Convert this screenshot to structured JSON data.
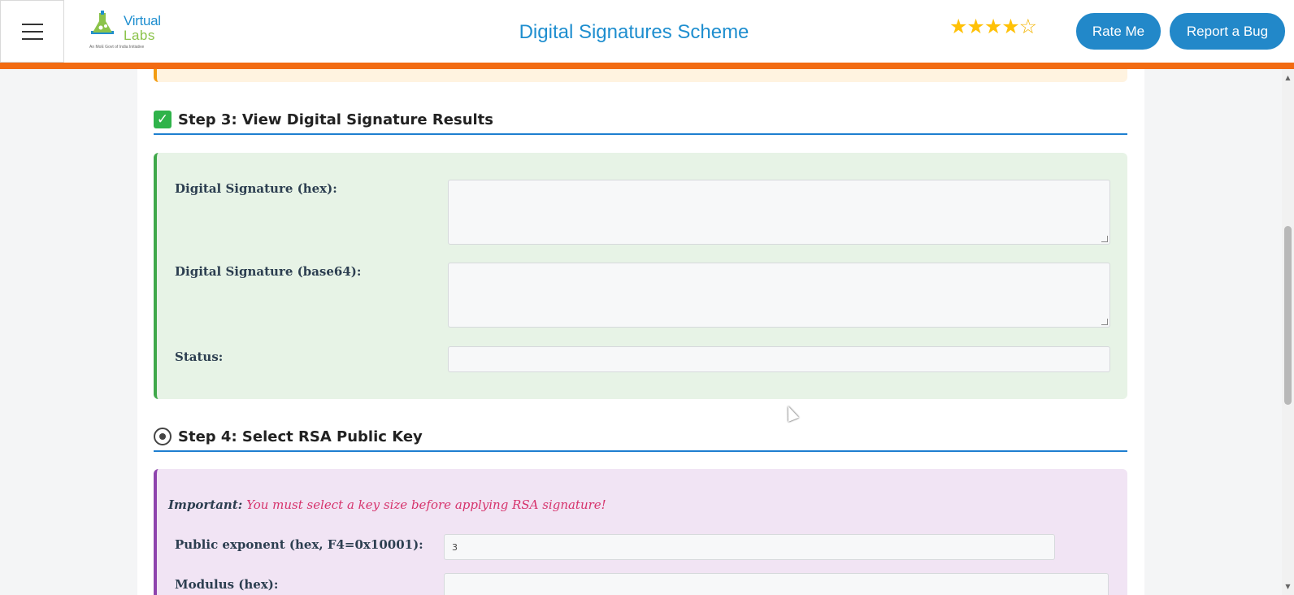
{
  "header": {
    "menu_icon": "hamburger-icon",
    "logo": {
      "line1": "Virtual",
      "line2": "Labs",
      "tagline": "An MoE Govt of India Initiative"
    },
    "title": "Digital Signatures Scheme",
    "rating": {
      "value": 4,
      "max": 5,
      "filled": "★★★★",
      "empty": "☆"
    },
    "rate_button": "Rate Me",
    "bug_button": "Report a Bug",
    "accent_color": "#f26b12"
  },
  "step3": {
    "icon": "check-icon",
    "title": "Step 3: View Digital Signature Results",
    "fields": {
      "sig_hex_label": "Digital Signature (hex):",
      "sig_hex_value": "",
      "sig_b64_label": "Digital Signature (base64):",
      "sig_b64_value": "",
      "status_label": "Status:",
      "status_value": ""
    }
  },
  "step4": {
    "icon": "gear-icon",
    "title": "Step 4: Select RSA Public Key",
    "important_label": "Important:",
    "important_msg": "You must select a key size before applying RSA signature!",
    "fields": {
      "exponent_label": "Public exponent (hex, F4=0x10001):",
      "exponent_value": "3",
      "modulus_label": "Modulus (hex):",
      "modulus_value": ""
    }
  },
  "colors": {
    "brand_blue": "#1e8ecf",
    "button_blue": "#2288c9",
    "green_panel": "#e7f3e6",
    "purple_panel": "#f1e4f4",
    "important_text": "#d6336c"
  }
}
